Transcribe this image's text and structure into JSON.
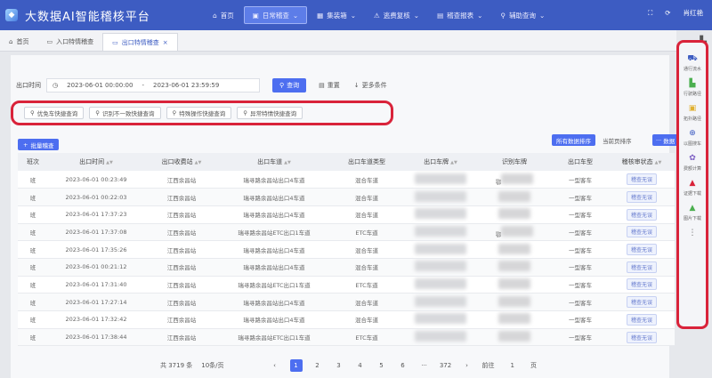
{
  "app": {
    "title": "大数据AI智能稽核平台",
    "logo_icon": "logo-icon",
    "brand_color": "#3d5cc2"
  },
  "nav": {
    "items": [
      {
        "label": "首页",
        "icon": "home-icon"
      },
      {
        "label": "日常稽查",
        "icon": "inspect-icon",
        "active": true
      },
      {
        "label": "集装箱",
        "icon": "container-icon"
      },
      {
        "label": "逃费复核",
        "icon": "warning-icon"
      },
      {
        "label": "稽查报表",
        "icon": "report-icon"
      },
      {
        "label": "辅助查询",
        "icon": "user-search-icon"
      }
    ]
  },
  "user": {
    "name": "肖红艳"
  },
  "tabs": [
    {
      "label": "首页",
      "icon": "home-icon"
    },
    {
      "label": "入口特情稽查",
      "icon": "doc-icon"
    },
    {
      "label": "出口特情稽查",
      "icon": "doc-icon",
      "active": true,
      "closable": true
    }
  ],
  "filter": {
    "time_label": "出口时间",
    "start": "2023-06-01 00:00:00",
    "end": "2023-06-01 23:59:59",
    "query_btn": "查询",
    "reset_btn": "重置",
    "more_btn": "更多条件"
  },
  "quick_queries": [
    "优免车快捷查询",
    "识别不一致快捷查询",
    "特殊操作快捷查询",
    "异常特情快捷查询"
  ],
  "toolbar": {
    "batch_btn": "批量稽查",
    "sort_all": "所有数据排序",
    "sort_page": "当前页排序",
    "export_btn": "数据"
  },
  "table": {
    "headers": [
      "班次",
      "出口时间",
      "出口收费站",
      "出口车道",
      "出口车道类型",
      "出口车牌",
      "识别车牌",
      "出口车型",
      "稽核审状态"
    ],
    "rows": [
      {
        "shift": "班",
        "time": "2023-06-01 00:23:49",
        "station": "江西余昌站",
        "lane": "瑞寻路余昌站出口4车道",
        "lane_type": "混合车道",
        "plate_tail": "鄂",
        "type": "一型客车",
        "status": "稽查无误"
      },
      {
        "shift": "班",
        "time": "2023-06-01 00:22:03",
        "station": "江西余昌站",
        "lane": "瑞寻路余昌站出口4车道",
        "lane_type": "混合车道",
        "plate_tail": "",
        "type": "一型客车",
        "status": "稽查无误"
      },
      {
        "shift": "班",
        "time": "2023-06-01 17:37:23",
        "station": "江西余昌站",
        "lane": "瑞寻路余昌站出口4车道",
        "lane_type": "混合车道",
        "plate_tail": "",
        "type": "一型客车",
        "status": "稽查无误"
      },
      {
        "shift": "班",
        "time": "2023-06-01 17:37:08",
        "station": "江西余昌站",
        "lane": "瑞寻路余昌站ETC出口1车道",
        "lane_type": "ETC车道",
        "plate_tail": "鄂",
        "type": "一型客车",
        "status": "稽查无误"
      },
      {
        "shift": "班",
        "time": "2023-06-01 17:35:26",
        "station": "江西余昌站",
        "lane": "瑞寻路余昌站出口4车道",
        "lane_type": "混合车道",
        "plate_tail": "",
        "type": "一型客车",
        "status": "稽查无误"
      },
      {
        "shift": "班",
        "time": "2023-06-01 00:21:12",
        "station": "江西余昌站",
        "lane": "瑞寻路余昌站出口4车道",
        "lane_type": "混合车道",
        "plate_tail": "",
        "type": "一型客车",
        "status": "稽查无误"
      },
      {
        "shift": "班",
        "time": "2023-06-01 17:31:40",
        "station": "江西余昌站",
        "lane": "瑞寻路余昌站ETC出口1车道",
        "lane_type": "ETC车道",
        "plate_tail": "",
        "type": "一型客车",
        "status": "稽查无误"
      },
      {
        "shift": "班",
        "time": "2023-06-01 17:27:14",
        "station": "江西余昌站",
        "lane": "瑞寻路余昌站出口4车道",
        "lane_type": "混合车道",
        "plate_tail": "",
        "type": "一型客车",
        "status": "稽查无误"
      },
      {
        "shift": "班",
        "time": "2023-06-01 17:32:42",
        "station": "江西余昌站",
        "lane": "瑞寻路余昌站出口4车道",
        "lane_type": "混合车道",
        "plate_tail": "",
        "type": "一型客车",
        "status": "稽查无误"
      },
      {
        "shift": "班",
        "time": "2023-06-01 17:38:44",
        "station": "江西余昌站",
        "lane": "瑞寻路余昌站ETC出口1车道",
        "lane_type": "ETC车道",
        "plate_tail": "",
        "type": "一型客车",
        "status": "稽查无误"
      }
    ]
  },
  "pager": {
    "total": "共 3719 条",
    "size": "10条/页",
    "pages": [
      "1",
      "2",
      "3",
      "4",
      "5",
      "6",
      "···",
      "372"
    ],
    "current": "1",
    "goto_label": "前往",
    "goto_value": "1",
    "page_suffix": "页"
  },
  "side_panel": {
    "items": [
      {
        "label": "通行流水",
        "icon": "vehicle-icon",
        "color": "#3d5cc2"
      },
      {
        "label": "行驶路径",
        "icon": "map-icon",
        "color": "#4caf50"
      },
      {
        "label": "拓扑路径",
        "icon": "topology-icon",
        "color": "#e0b030"
      },
      {
        "label": "以图搜车",
        "icon": "image-search-icon",
        "color": "#3d5cc2"
      },
      {
        "label": "费额计算",
        "icon": "calc-icon",
        "color": "#7a5cc2"
      },
      {
        "label": "证据下载",
        "icon": "download-icon",
        "color": "#d9233a"
      },
      {
        "label": "图片下载",
        "icon": "image-download-icon",
        "color": "#4caf50"
      },
      {
        "label": "",
        "icon": "more-icon",
        "color": "#666"
      }
    ]
  },
  "highlight_color": "#d9233a"
}
